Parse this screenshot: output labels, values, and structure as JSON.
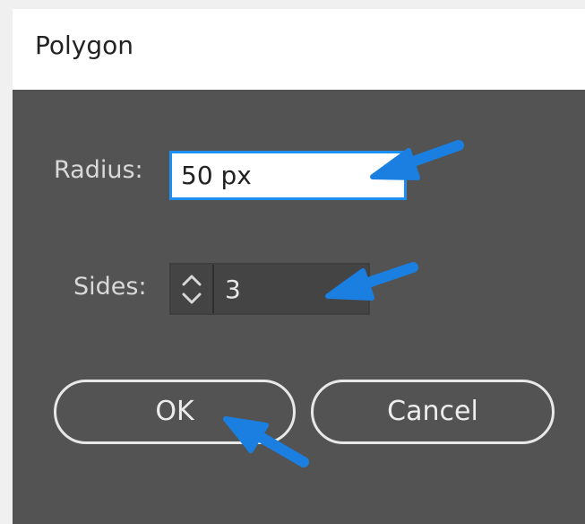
{
  "dialog": {
    "title": "Polygon"
  },
  "radius": {
    "label": "Radius:",
    "value": "50 px"
  },
  "sides": {
    "label": "Sides:",
    "value": "3"
  },
  "buttons": {
    "ok_label": "OK",
    "cancel_label": "Cancel"
  },
  "annotations": {
    "arrow_color": "#1a7fe0"
  },
  "colors": {
    "dialog_background": "#535353",
    "focus_border": "#1f8ef1"
  },
  "icons": {
    "spinner_up": "chevron-up-icon",
    "spinner_down": "chevron-down-icon"
  }
}
